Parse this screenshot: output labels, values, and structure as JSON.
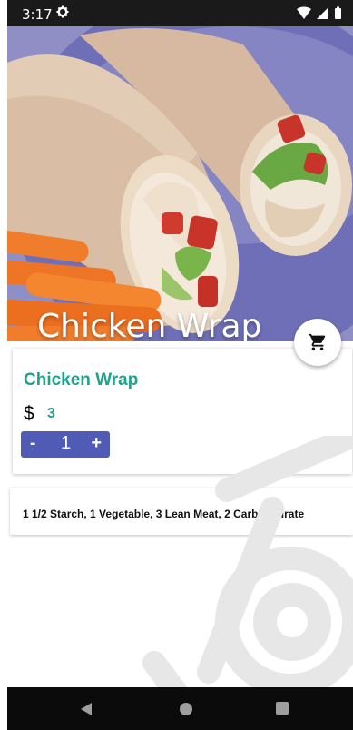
{
  "status_bar": {
    "time": "3:17"
  },
  "hero": {
    "title": "Chicken Wrap"
  },
  "product": {
    "name": "Chicken Wrap",
    "currency": "$",
    "price": "3",
    "quantity": {
      "minus": "-",
      "value": "1",
      "plus": "+"
    }
  },
  "exchange": {
    "text": "1 1/2 Starch, 1 Vegetable, 3 Lean Meat, 2 Carbohydrate"
  },
  "icons": {
    "settings": "gear-icon",
    "wifi": "wifi-icon",
    "signal": "signal-icon",
    "battery": "battery-icon",
    "cart": "cart-icon",
    "back": "back-icon",
    "home": "home-icon",
    "recents": "recents-icon"
  },
  "colors": {
    "accent": "#1fa28a",
    "stepper": "#4f5bb5",
    "status_bar": "#1a1a1a",
    "nav_bar": "#0b0b0b"
  }
}
